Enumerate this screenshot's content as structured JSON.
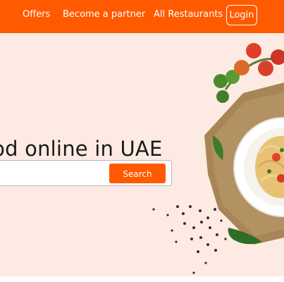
{
  "nav": {
    "offers": "Offers",
    "partner": "Become a partner",
    "restaurants": "All Restaurants",
    "login": "Login"
  },
  "hero": {
    "headline": "Order food online in UAE",
    "search_placeholder": "",
    "search_button": "Search"
  },
  "colors": {
    "brand": "#ff5a00",
    "hero_bg": "#fdebe3"
  }
}
